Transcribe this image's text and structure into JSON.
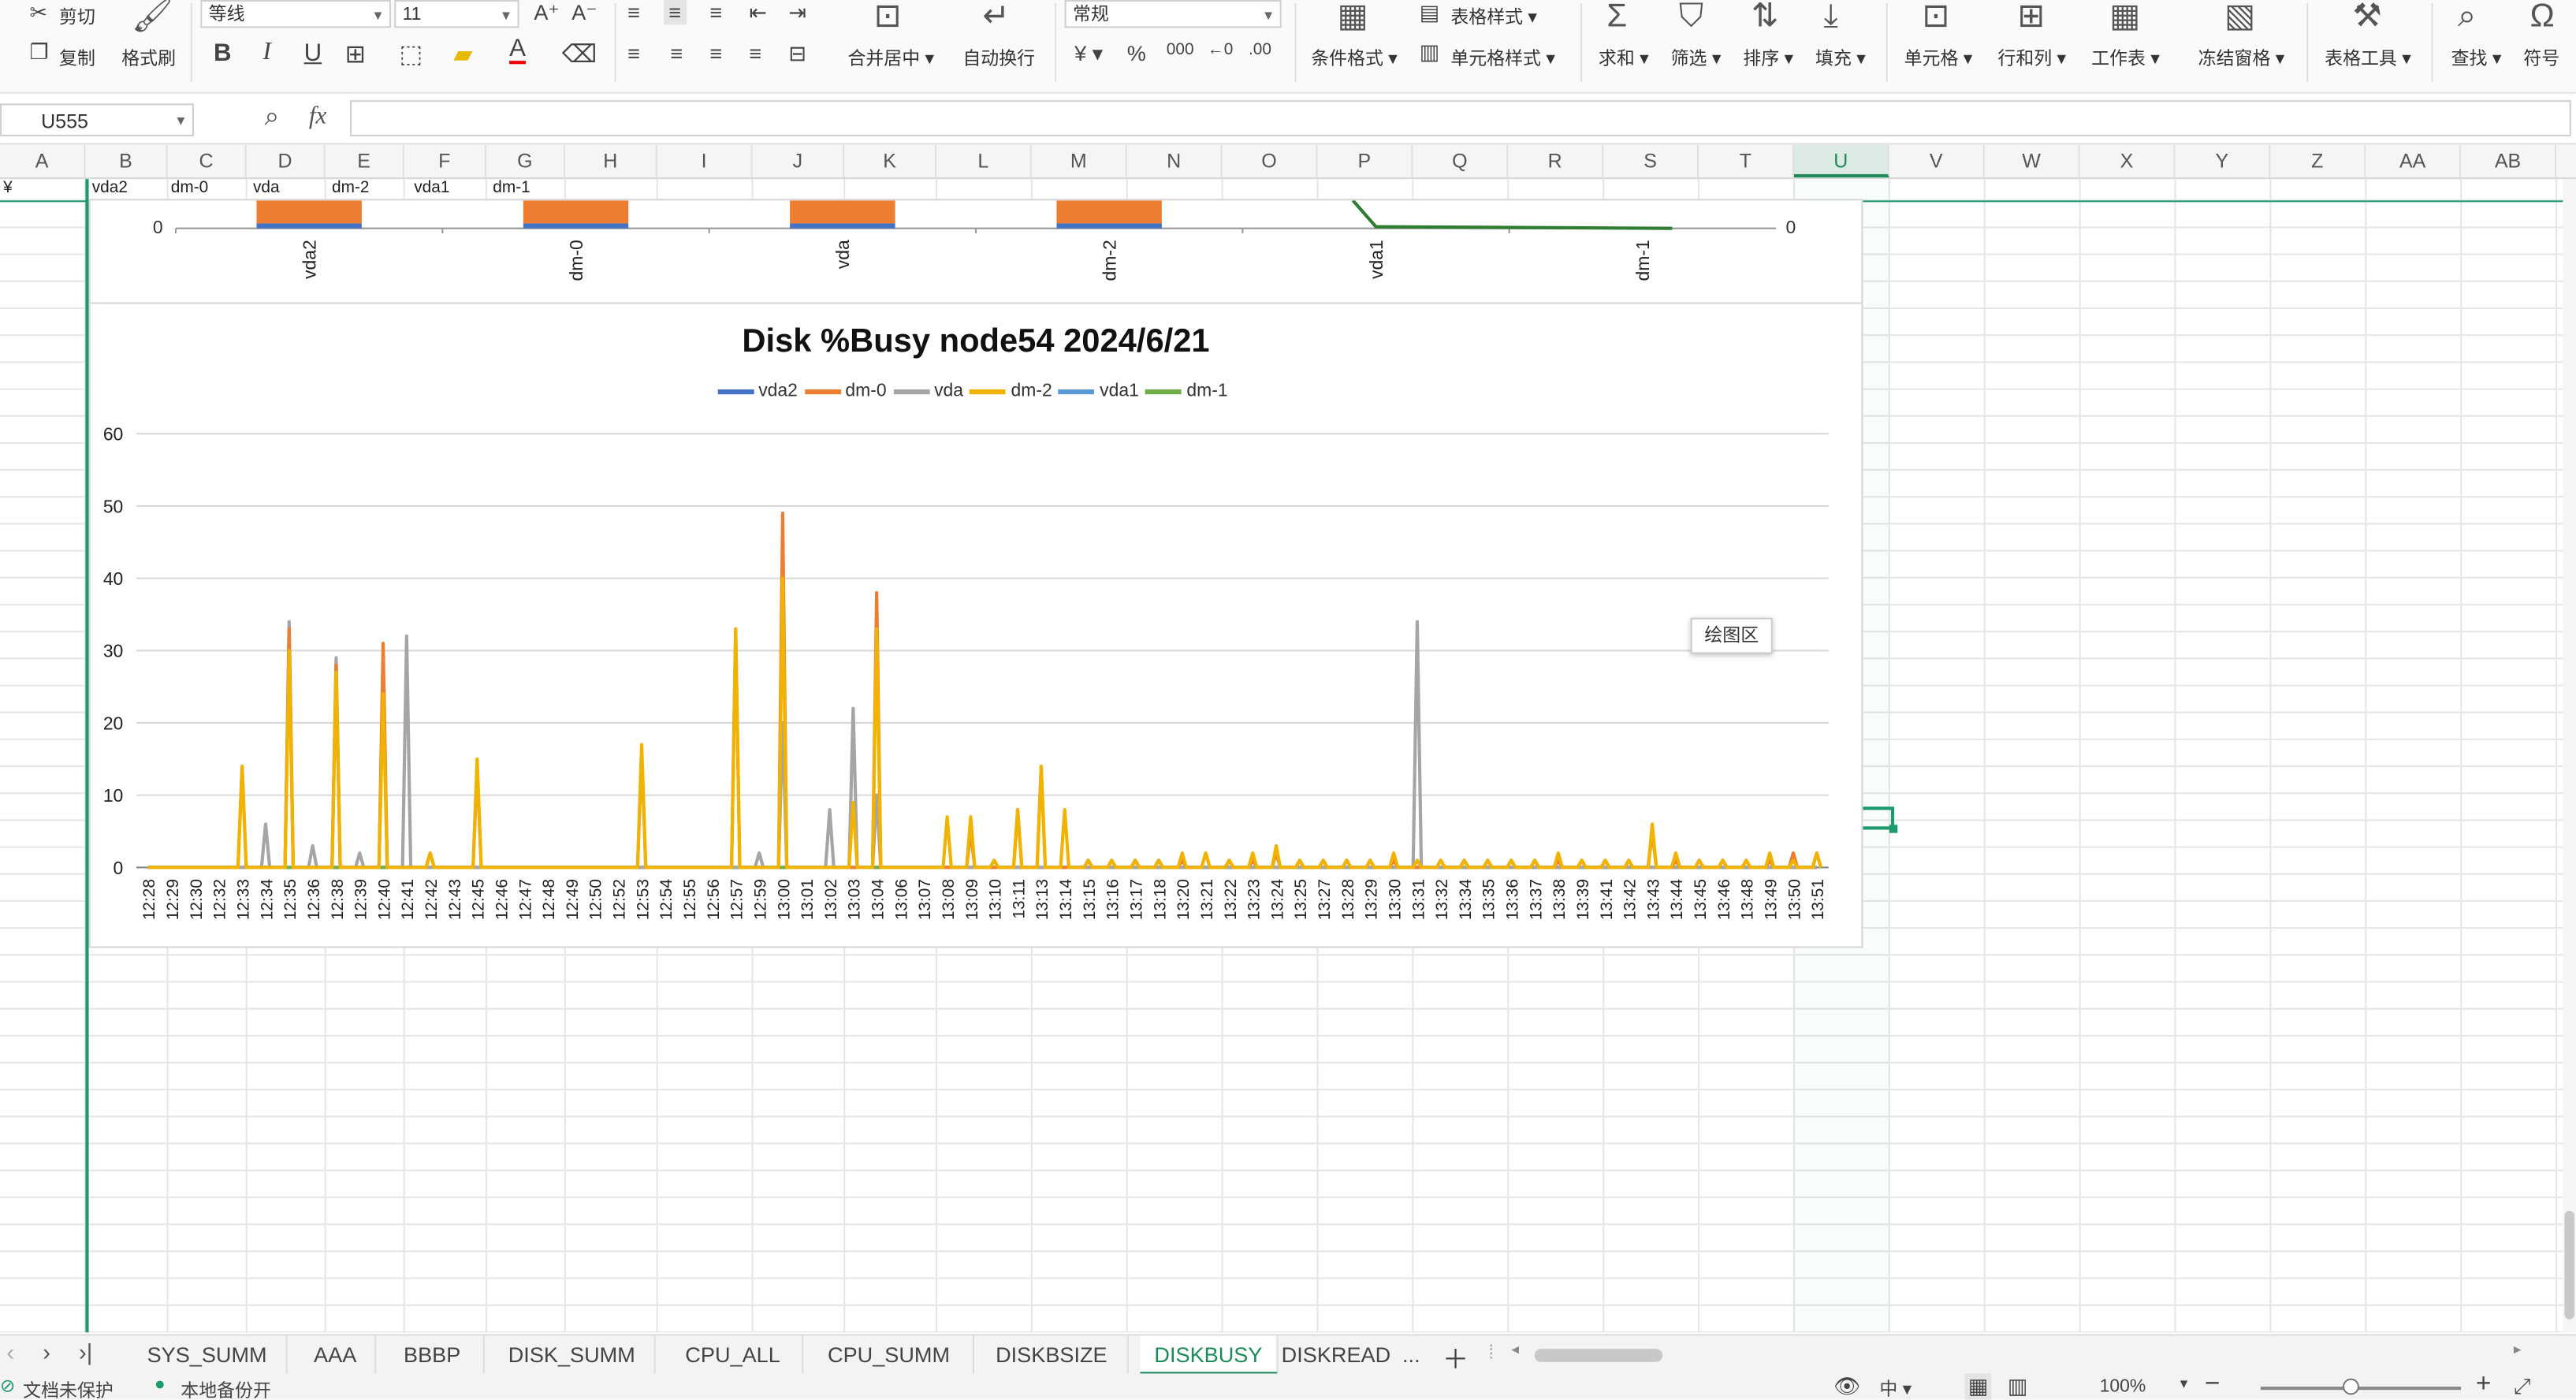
{
  "ribbon": {
    "cut": "剪切",
    "copy": "复制",
    "format_painter": "格式刷",
    "font_name": "等线",
    "font_size": "11",
    "merge_center": "合并居中",
    "wrap_text": "自动换行",
    "number_format": "常规",
    "conditional_format": "条件格式",
    "table_style": "表格样式",
    "cell_style": "单元格样式",
    "sum": "求和",
    "filter": "筛选",
    "sort": "排序",
    "fill": "填充",
    "cell": "单元格",
    "rows_cols": "行和列",
    "worksheet": "工作表",
    "freeze": "冻结窗格",
    "table_tools": "表格工具",
    "find": "查找",
    "symbol": "符号"
  },
  "formula_bar": {
    "name_box": "U555",
    "fx": "fx",
    "value": ""
  },
  "columns": [
    "A",
    "B",
    "C",
    "D",
    "E",
    "F",
    "G",
    "H",
    "I",
    "J",
    "K",
    "L",
    "M",
    "N",
    "O",
    "P",
    "Q",
    "R",
    "S",
    "T",
    "U",
    "V",
    "W",
    "X",
    "Y",
    "Z",
    "AA",
    "AB"
  ],
  "row_cells": {
    "a": "¥",
    "b": "vda2",
    "c": "dm-0",
    "d": "vda",
    "e": "dm-2",
    "f": "vda1",
    "g": "dm-1"
  },
  "top_chart": {
    "left_tick": "0",
    "right_tick": "0",
    "categories": [
      "vda2",
      "dm-0",
      "vda",
      "dm-2",
      "vda1",
      "dm-1"
    ]
  },
  "chart_data": {
    "type": "line",
    "title": "Disk %Busy node54  2024/6/21",
    "ylim": [
      0,
      60
    ],
    "yticks": [
      "0",
      "10",
      "20",
      "30",
      "40",
      "50",
      "60"
    ],
    "grid": true,
    "legend_position": "top",
    "x": [
      "12:28",
      "12:29",
      "12:30",
      "12:32",
      "12:33",
      "12:34",
      "12:35",
      "12:36",
      "12:38",
      "12:39",
      "12:40",
      "12:41",
      "12:42",
      "12:43",
      "12:45",
      "12:46",
      "12:47",
      "12:48",
      "12:49",
      "12:50",
      "12:52",
      "12:53",
      "12:54",
      "12:55",
      "12:56",
      "12:57",
      "12:59",
      "13:00",
      "13:01",
      "13:02",
      "13:03",
      "13:04",
      "13:06",
      "13:07",
      "13:08",
      "13:09",
      "13:10",
      "13:11",
      "13:13",
      "13:14",
      "13:15",
      "13:16",
      "13:17",
      "13:18",
      "13:20",
      "13:21",
      "13:22",
      "13:23",
      "13:24",
      "13:25",
      "13:27",
      "13:28",
      "13:29",
      "13:30",
      "13:31",
      "13:32",
      "13:34",
      "13:35",
      "13:36",
      "13:37",
      "13:38",
      "13:39",
      "13:41",
      "13:42",
      "13:43",
      "13:44",
      "13:45",
      "13:46",
      "13:48",
      "13:49",
      "13:50",
      "13:51"
    ],
    "series": [
      {
        "name": "vda2",
        "color": "#4472c4",
        "values": [
          0,
          0,
          0,
          0,
          0,
          0,
          0,
          0,
          0,
          0,
          0,
          0,
          0,
          0,
          0,
          0,
          0,
          0,
          0,
          0,
          0,
          0,
          0,
          0,
          0,
          0,
          0,
          0,
          0,
          0,
          0,
          0,
          0,
          0,
          0,
          0,
          0,
          0,
          0,
          0,
          0,
          0,
          0,
          0,
          0,
          0,
          0,
          0,
          0,
          0,
          0,
          0,
          0,
          0,
          0,
          0,
          0,
          0,
          0,
          0,
          0,
          0,
          0,
          0,
          0,
          0,
          0,
          0,
          0,
          0,
          0,
          0
        ]
      },
      {
        "name": "dm-0",
        "color": "#ed7d31",
        "values": [
          0,
          0,
          0,
          0,
          14,
          0,
          33,
          0,
          28,
          0,
          31,
          0,
          2,
          0,
          14,
          0,
          0,
          0,
          0,
          0,
          0,
          16,
          0,
          0,
          0,
          33,
          0,
          49,
          0,
          0,
          0,
          38,
          0,
          0,
          0,
          5,
          0,
          8,
          14,
          0,
          1,
          1,
          1,
          1,
          1,
          2,
          1,
          1,
          2,
          1,
          1,
          1,
          1,
          1,
          0,
          1,
          1,
          1,
          1,
          1,
          1,
          1,
          1,
          1,
          5,
          1,
          1,
          1,
          1,
          1,
          2,
          2
        ]
      },
      {
        "name": "vda",
        "color": "#a5a5a5",
        "values": [
          0,
          0,
          0,
          0,
          0,
          6,
          34,
          3,
          29,
          2,
          27,
          32,
          0,
          0,
          0,
          0,
          0,
          0,
          0,
          0,
          0,
          0,
          0,
          0,
          0,
          0,
          2,
          20,
          0,
          8,
          22,
          10,
          0,
          0,
          0,
          0,
          0,
          0,
          0,
          0,
          0,
          0,
          0,
          0,
          0,
          0,
          0,
          0,
          0,
          0,
          0,
          0,
          0,
          0,
          34,
          0,
          0,
          0,
          0,
          0,
          0,
          0,
          0,
          0,
          0,
          0,
          0,
          0,
          0,
          0,
          0,
          0
        ]
      },
      {
        "name": "dm-2",
        "color": "#f0b400",
        "values": [
          0,
          0,
          0,
          0,
          14,
          0,
          30,
          0,
          27,
          0,
          24,
          0,
          2,
          0,
          15,
          0,
          0,
          0,
          0,
          0,
          0,
          17,
          0,
          0,
          0,
          33,
          0,
          40,
          0,
          0,
          9,
          33,
          0,
          0,
          7,
          7,
          1,
          8,
          14,
          8,
          1,
          1,
          1,
          1,
          2,
          2,
          1,
          2,
          3,
          1,
          1,
          1,
          1,
          2,
          1,
          1,
          1,
          1,
          1,
          1,
          2,
          1,
          1,
          1,
          6,
          2,
          1,
          1,
          1,
          2,
          1,
          2
        ]
      },
      {
        "name": "vda1",
        "color": "#5b9bd5",
        "values": [
          0,
          0,
          0,
          0,
          0,
          0,
          0,
          0,
          0,
          0,
          0,
          0,
          0,
          0,
          0,
          0,
          0,
          0,
          0,
          0,
          0,
          0,
          0,
          0,
          0,
          0,
          0,
          0,
          0,
          0,
          0,
          0,
          0,
          0,
          0,
          0,
          0,
          0,
          0,
          0,
          0,
          0,
          0,
          0,
          0,
          0,
          0,
          0,
          0,
          0,
          0,
          0,
          0,
          0,
          0,
          0,
          0,
          0,
          0,
          0,
          0,
          0,
          0,
          0,
          0,
          0,
          0,
          0,
          0,
          0,
          0,
          0
        ]
      },
      {
        "name": "dm-1",
        "color": "#70ad47",
        "values": [
          0,
          0,
          0,
          0,
          0,
          0,
          0,
          0,
          0,
          0,
          0,
          0,
          0,
          0,
          0,
          0,
          0,
          0,
          0,
          0,
          0,
          0,
          0,
          0,
          0,
          0,
          0,
          0,
          0,
          0,
          0,
          0,
          0,
          0,
          0,
          0,
          0,
          0,
          0,
          0,
          0,
          0,
          0,
          0,
          0,
          0,
          0,
          0,
          0,
          0,
          0,
          0,
          0,
          0,
          0,
          0,
          0,
          0,
          0,
          0,
          0,
          0,
          0,
          0,
          0,
          0,
          0,
          0,
          0,
          0,
          0,
          0
        ]
      }
    ]
  },
  "chart_tooltip": "绘图区",
  "sheet_tabs": [
    "SYS_SUMM",
    "AAA",
    "BBBP",
    "DISK_SUMM",
    "CPU_ALL",
    "CPU_SUMM",
    "DISKBSIZE",
    "DISKBUSY",
    "DISKREAD"
  ],
  "active_tab": "DISKBUSY",
  "tab_more": "...",
  "status": {
    "protect": "文档未保护",
    "backup": "本地备份开",
    "zoom": "100%",
    "input_mode": "中"
  }
}
